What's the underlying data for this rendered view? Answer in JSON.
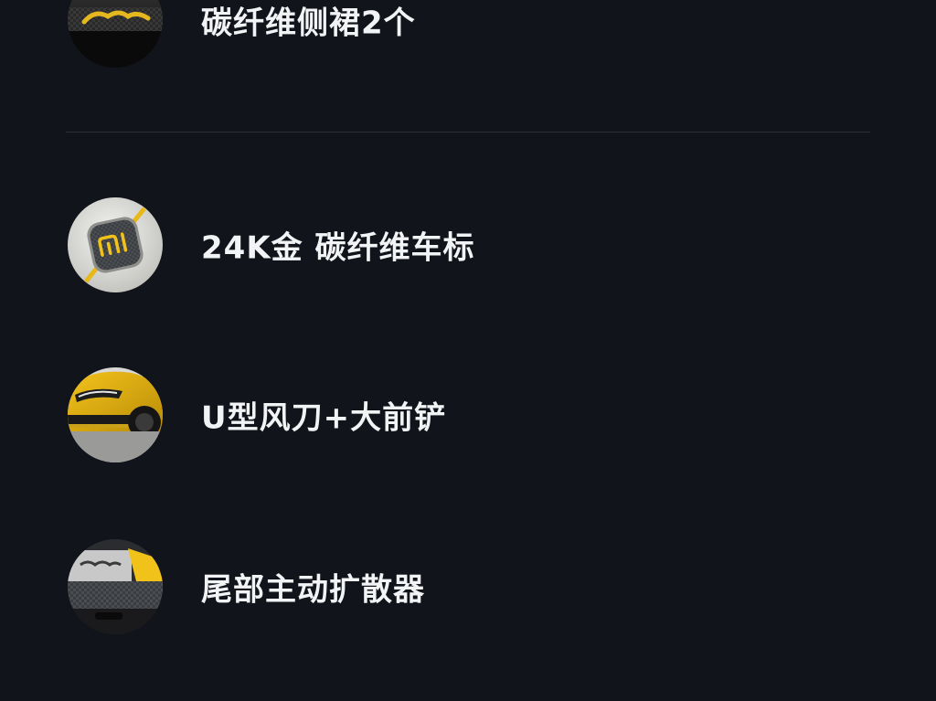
{
  "features": [
    {
      "label": "碳纤维侧裙2个",
      "icon": "carbon-side-skirt-icon"
    },
    {
      "label": "24K金 碳纤维车标",
      "icon": "gold-carbon-badge-icon"
    },
    {
      "label": "U型风刀+大前铲",
      "icon": "front-splitter-icon"
    },
    {
      "label": "尾部主动扩散器",
      "icon": "rear-diffuser-icon"
    }
  ],
  "colors": {
    "background": "#12141c",
    "text": "#f2f3f5",
    "divider": "#2c2f38",
    "accent_yellow": "#f0c21a"
  }
}
